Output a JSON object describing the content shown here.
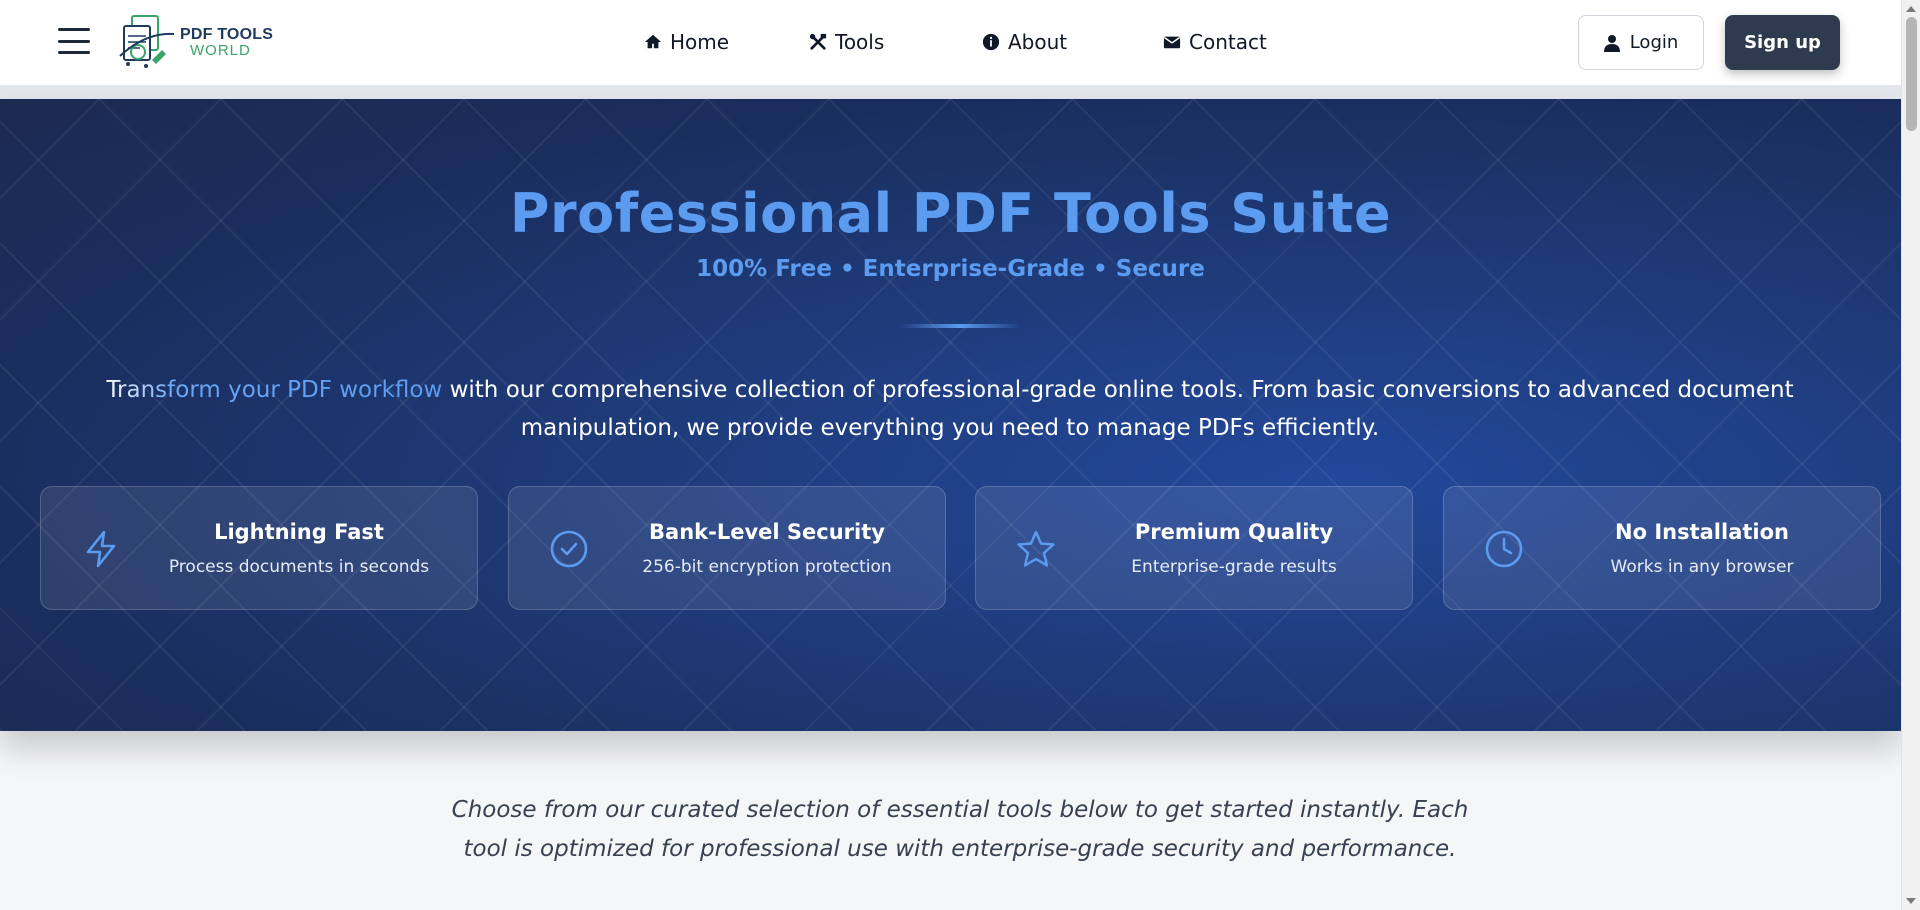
{
  "header": {
    "logo": {
      "line1": "PDF TOOLS",
      "line2": "WORLD"
    },
    "nav": [
      {
        "label": "Home",
        "icon": "home-icon"
      },
      {
        "label": "Tools",
        "icon": "tools-icon"
      },
      {
        "label": "About",
        "icon": "info-icon"
      },
      {
        "label": "Contact",
        "icon": "envelope-icon"
      }
    ],
    "login_label": "Login",
    "signup_label": "Sign up"
  },
  "hero": {
    "title": "Professional PDF Tools Suite",
    "subtitle": "100% Free • Enterprise-Grade • Secure",
    "description_highlight": "Transform your PDF workflow",
    "description_rest": " with our comprehensive collection of professional-grade online tools. From basic conversions to advanced document manipulation, we provide everything you need to manage PDFs efficiently.",
    "features": [
      {
        "title": "Lightning Fast",
        "desc": "Process documents in seconds",
        "icon": "lightning-icon"
      },
      {
        "title": "Bank-Level Security",
        "desc": "256-bit encryption protection",
        "icon": "check-circle-icon"
      },
      {
        "title": "Premium Quality",
        "desc": "Enterprise-grade results",
        "icon": "star-icon"
      },
      {
        "title": "No Installation",
        "desc": "Works in any browser",
        "icon": "clock-icon"
      }
    ]
  },
  "intro": {
    "text": "Choose from our curated selection of essential tools below to get started instantly. Each tool is optimized for professional use with enterprise-grade security and performance."
  },
  "colors": {
    "accent": "#5b9cf0",
    "hero_bg": "#1e3a78",
    "signup_bg": "#2e3b4e"
  }
}
